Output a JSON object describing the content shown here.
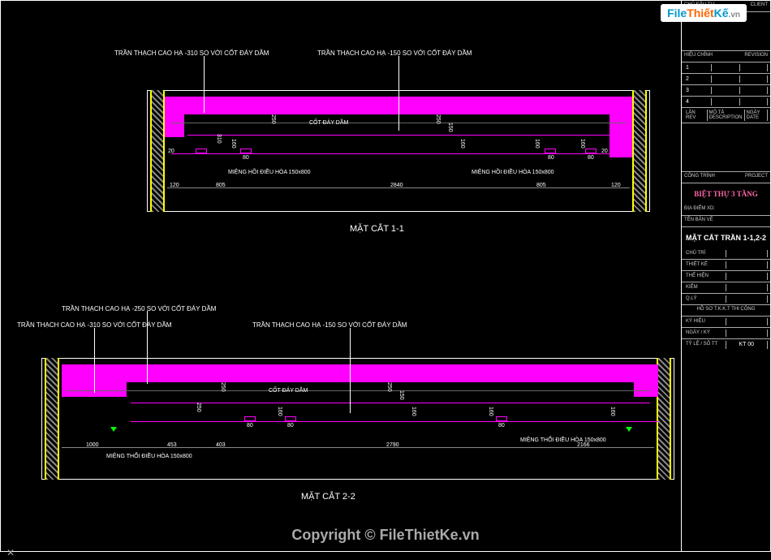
{
  "logo": {
    "file": "File",
    "thiet": "Thiết",
    "ke": "Kế",
    "vn": ".vn"
  },
  "watermark": "Copyright © FileThietKe.vn",
  "titleblock": {
    "header": {
      "left": "CHỦ ĐẦU TƯ",
      "right": "CLIENT"
    },
    "rev_header": {
      "left": "HIỆU CHỈNH",
      "right": "REVISION"
    },
    "revs": [
      "1",
      "2",
      "3",
      "4"
    ],
    "lan": "LẦN REV",
    "mota": "MÔ TẢ DESCRIPTION",
    "ngay": "NGÀY DATE",
    "congtrinh": {
      "left": "CÔNG TRÌNH",
      "right": "PROJECT"
    },
    "project_name": "BIỆT THỰ 3 TẦNG",
    "diachi": "ĐỊA ĐIỂM XD:",
    "tenban": "TÊN BẢN VẼ",
    "drawing_name": "MẶT CẮT TRẦN 1-1,2-2",
    "roles": [
      "CHỦ TRÌ",
      "THIẾT KẾ",
      "THỂ HIỆN",
      "KIỂM",
      "Q.LÝ"
    ],
    "hoso": "HỒ SƠ T.K.K.T THI CÔNG",
    "footer": {
      "kyhieu": "KÝ HIỆU",
      "ngaylbl": "NGÀY / KÝ",
      "tyle": "TỶ LỆ / SỐ TT"
    },
    "sheet_no": "KT 00"
  },
  "section1": {
    "title": "MẶT CẮT 1-1",
    "labels": {
      "l1": "TRẦN THẠCH CAO HẠ -310 SO VỚI CỐT ĐÁY DẦM",
      "l2": "TRẦN THẠCH CAO HẠ -150 SO VỚI CỐT ĐÁY DẦM",
      "cot": "CỐT ĐÁY DẦM",
      "vent1": "MIỆNG HỒI ĐIỀU HÒA 150x800",
      "vent2": "MIỆNG HỒI ĐIỀU HÒA 150x800"
    },
    "dims": {
      "v1": "250",
      "v2": "310",
      "v3": "160",
      "v4": "150",
      "v5": "160",
      "h1": "120",
      "h2": "805",
      "h3": "2840",
      "h4": "805",
      "h5": "120",
      "h6": "80",
      "h7": "80",
      "h8": "80",
      "h9": "20"
    }
  },
  "section2": {
    "title": "MẶT CẮT 2-2",
    "labels": {
      "l1": "TRẦN THẠCH CAO HẠ -250 SO VỚI CỐT ĐÁY DẦM",
      "l2": "TRẦN THẠCH CAO HẠ -310 SO VỚI CỐT ĐÁY DẦM",
      "l3": "TRẦN THẠCH CAO HẠ -150 SO VỚI CỐT ĐÁY DẦM",
      "cot": "CỐT ĐÁY DẦM",
      "vent1": "MIỆNG THỔI ĐIỀU HÒA 150x800",
      "vent2": "MIỆNG THỔI ĐIỀU HÒA 150x800"
    },
    "dims": {
      "v1": "250",
      "v2": "250",
      "v3": "150",
      "v4": "160",
      "v5": "160",
      "h1": "1000",
      "h2": "453",
      "h3": "403",
      "h4": "2790",
      "h5": "2166",
      "h6": "80",
      "h7": "80"
    }
  }
}
